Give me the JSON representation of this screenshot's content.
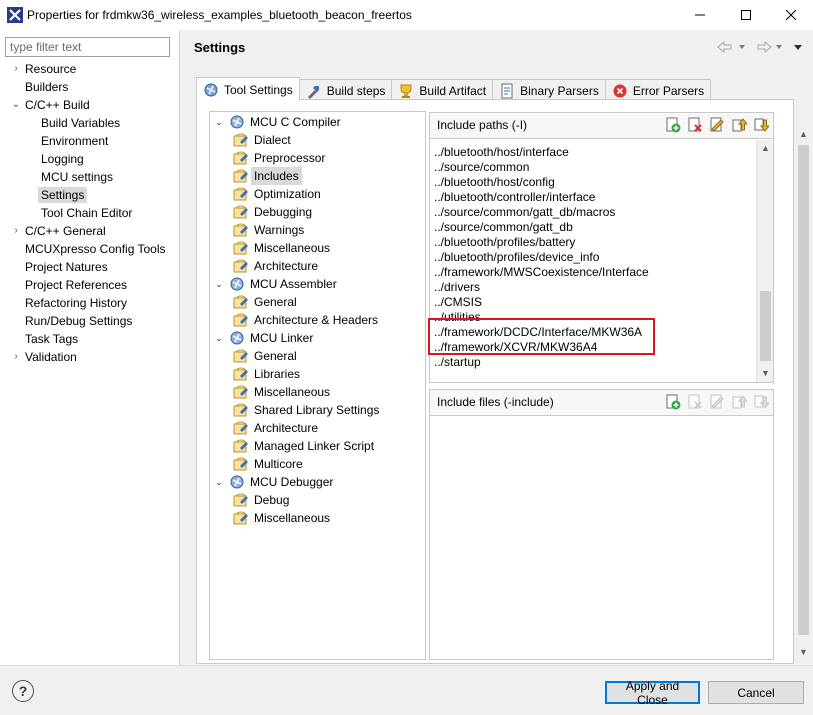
{
  "window": {
    "title": "Properties for frdmkw36_wireless_examples_bluetooth_beacon_freertos",
    "minimize": "—",
    "maximize": "☐",
    "close": "✕"
  },
  "filter": {
    "placeholder": "type filter text",
    "value": ""
  },
  "nav": {
    "items": [
      {
        "label": "Resource",
        "arrow": "›",
        "indent": 0
      },
      {
        "label": "Builders",
        "arrow": "",
        "indent": 0
      },
      {
        "label": "C/C++ Build",
        "arrow": "⌄",
        "indent": 0
      },
      {
        "label": "Build Variables",
        "arrow": "",
        "indent": 1
      },
      {
        "label": "Environment",
        "arrow": "",
        "indent": 1
      },
      {
        "label": "Logging",
        "arrow": "",
        "indent": 1
      },
      {
        "label": "MCU settings",
        "arrow": "",
        "indent": 1
      },
      {
        "label": "Settings",
        "arrow": "",
        "indent": 1,
        "selected": true
      },
      {
        "label": "Tool Chain Editor",
        "arrow": "",
        "indent": 1
      },
      {
        "label": "C/C++ General",
        "arrow": "›",
        "indent": 0
      },
      {
        "label": "MCUXpresso Config Tools",
        "arrow": "",
        "indent": 0
      },
      {
        "label": "Project Natures",
        "arrow": "",
        "indent": 0
      },
      {
        "label": "Project References",
        "arrow": "",
        "indent": 0
      },
      {
        "label": "Refactoring History",
        "arrow": "",
        "indent": 0
      },
      {
        "label": "Run/Debug Settings",
        "arrow": "",
        "indent": 0
      },
      {
        "label": "Task Tags",
        "arrow": "",
        "indent": 0
      },
      {
        "label": "Validation",
        "arrow": "›",
        "indent": 0
      }
    ]
  },
  "page": {
    "title": "Settings"
  },
  "tabs": [
    {
      "label": "Tool Settings",
      "active": true,
      "icon": "tool-settings-icon"
    },
    {
      "label": "Build steps",
      "active": false,
      "icon": "build-steps-icon"
    },
    {
      "label": "Build Artifact",
      "active": false,
      "icon": "build-artifact-icon"
    },
    {
      "label": "Binary Parsers",
      "active": false,
      "icon": "binary-parsers-icon"
    },
    {
      "label": "Error Parsers",
      "active": false,
      "icon": "error-parsers-icon"
    }
  ],
  "tree": [
    {
      "label": "MCU C Compiler",
      "level": 0,
      "expand": "⌄",
      "icon": "tool-icon"
    },
    {
      "label": "Dialect",
      "level": 1,
      "icon": "option-icon"
    },
    {
      "label": "Preprocessor",
      "level": 1,
      "icon": "option-icon"
    },
    {
      "label": "Includes",
      "level": 1,
      "icon": "option-icon",
      "selected": true
    },
    {
      "label": "Optimization",
      "level": 1,
      "icon": "option-icon"
    },
    {
      "label": "Debugging",
      "level": 1,
      "icon": "option-icon"
    },
    {
      "label": "Warnings",
      "level": 1,
      "icon": "option-icon"
    },
    {
      "label": "Miscellaneous",
      "level": 1,
      "icon": "option-icon"
    },
    {
      "label": "Architecture",
      "level": 1,
      "icon": "option-icon"
    },
    {
      "label": "MCU Assembler",
      "level": 0,
      "expand": "⌄",
      "icon": "tool-icon"
    },
    {
      "label": "General",
      "level": 1,
      "icon": "option-icon"
    },
    {
      "label": "Architecture & Headers",
      "level": 1,
      "icon": "option-icon"
    },
    {
      "label": "MCU Linker",
      "level": 0,
      "expand": "⌄",
      "icon": "tool-icon"
    },
    {
      "label": "General",
      "level": 1,
      "icon": "option-icon"
    },
    {
      "label": "Libraries",
      "level": 1,
      "icon": "option-icon"
    },
    {
      "label": "Miscellaneous",
      "level": 1,
      "icon": "option-icon"
    },
    {
      "label": "Shared Library Settings",
      "level": 1,
      "icon": "option-icon"
    },
    {
      "label": "Architecture",
      "level": 1,
      "icon": "option-icon"
    },
    {
      "label": "Managed Linker Script",
      "level": 1,
      "icon": "option-icon"
    },
    {
      "label": "Multicore",
      "level": 1,
      "icon": "option-icon"
    },
    {
      "label": "MCU Debugger",
      "level": 0,
      "expand": "⌄",
      "icon": "tool-icon"
    },
    {
      "label": "Debug",
      "level": 1,
      "icon": "option-icon"
    },
    {
      "label": "Miscellaneous",
      "level": 1,
      "icon": "option-icon"
    }
  ],
  "include_paths": {
    "title": "Include paths (-I)",
    "items": [
      "../bluetooth/host/interface",
      "../source/common",
      "../bluetooth/host/config",
      "../bluetooth/controller/interface",
      "../source/common/gatt_db/macros",
      "../source/common/gatt_db",
      "../bluetooth/profiles/battery",
      "../bluetooth/profiles/device_info",
      "../framework/MWSCoexistence/Interface",
      "../drivers",
      "../CMSIS",
      "../utilities",
      "../framework/DCDC/Interface/MKW36A",
      "../framework/XCVR/MKW36A4",
      "../startup"
    ]
  },
  "include_files": {
    "title": "Include files (-include)"
  },
  "buttons": {
    "help": "?",
    "apply_close": "Apply and Close",
    "cancel": "Cancel"
  },
  "colors": {
    "highlight": "#e0141e",
    "accent": "#0078d7"
  }
}
